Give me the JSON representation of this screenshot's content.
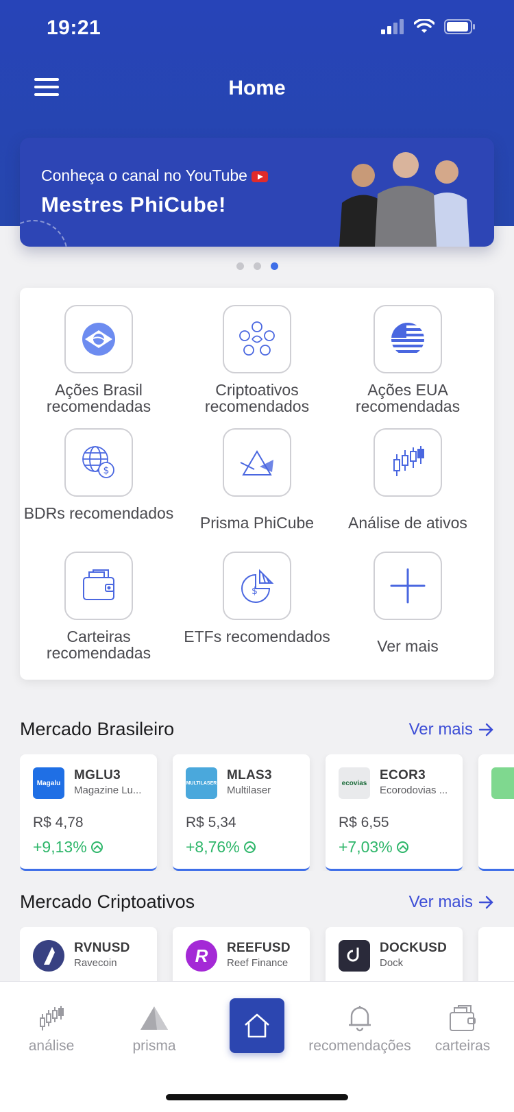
{
  "status": {
    "time": "19:21"
  },
  "nav": {
    "title": "Home"
  },
  "banner": {
    "subtitle": "Conheça o canal no YouTube",
    "title": "Mestres PhiCube!"
  },
  "carousel": {
    "total": 3,
    "active": 3
  },
  "menu": [
    {
      "label": "Ações Brasil recomendadas",
      "icon": "brazil-flag-icon"
    },
    {
      "label": "Criptoativos recomendados",
      "icon": "crypto-coins-icon"
    },
    {
      "label": "Ações EUA recomendadas",
      "icon": "usa-flag-icon"
    },
    {
      "label": "BDRs recomendados",
      "icon": "globe-dollar-icon"
    },
    {
      "label": "Prisma PhiCube",
      "icon": "prism-icon"
    },
    {
      "label": "Análise de ativos",
      "icon": "candlestick-icon"
    },
    {
      "label": "Carteiras recomendadas",
      "icon": "wallet-icon"
    },
    {
      "label": "ETFs recomendados",
      "icon": "pie-dollar-icon"
    },
    {
      "label": "Ver mais",
      "icon": "plus-icon"
    }
  ],
  "brazil_market": {
    "title": "Mercado Brasileiro",
    "more": "Ver mais",
    "stocks": [
      {
        "ticker": "MGLU3",
        "name": "Magazine Lu...",
        "price": "R$ 4,78",
        "change": "+9,13%",
        "logo_text": "Magalu",
        "logo_color": "#1f6fe5"
      },
      {
        "ticker": "MLAS3",
        "name": "Multilaser",
        "price": "R$ 5,34",
        "change": "+8,76%",
        "logo_text": "MULTILASER",
        "logo_color": "#4aa8dc"
      },
      {
        "ticker": "ECOR3",
        "name": "Ecorodovias ...",
        "price": "R$ 6,55",
        "change": "+7,03%",
        "logo_text": "ecovias",
        "logo_color": "#e9eaec"
      }
    ]
  },
  "crypto_market": {
    "title": "Mercado Criptoativos",
    "more": "Ver mais",
    "coins": [
      {
        "ticker": "RVNUSD",
        "name": "Ravecoin",
        "logo_color": "#384182"
      },
      {
        "ticker": "REEFUSD",
        "name": "Reef Finance",
        "logo_color": "#a429d6"
      },
      {
        "ticker": "DOCKUSD",
        "name": "Dock",
        "logo_color": "#2a2a3a"
      }
    ]
  },
  "tabs": [
    {
      "label": "análise",
      "icon": "candlestick-icon"
    },
    {
      "label": "prisma",
      "icon": "prism-icon"
    },
    {
      "label": "",
      "icon": "home-icon"
    },
    {
      "label": "recomendações",
      "icon": "bell-icon"
    },
    {
      "label": "carteiras",
      "icon": "wallet-icon"
    }
  ],
  "colors": {
    "primary": "#2744b8",
    "accent": "#3e6ee8",
    "positive": "#2eb66a",
    "link": "#3c4dd6"
  }
}
